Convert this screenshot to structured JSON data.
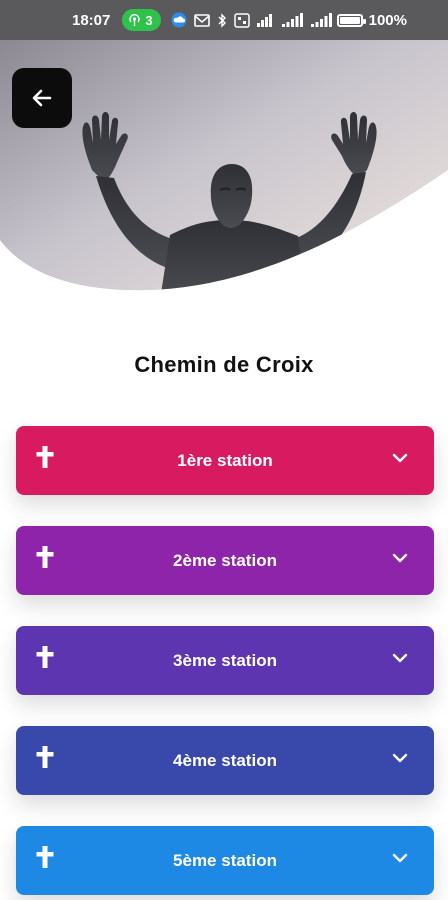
{
  "status_bar": {
    "time": "18:07",
    "hotspot_count": "3",
    "battery_percent": "100%",
    "battery_level": 1.0
  },
  "header": {
    "back_icon": "arrow-left-icon",
    "image": "christ-statue-raised-arms"
  },
  "page": {
    "title": "Chemin de Croix"
  },
  "stations": [
    {
      "label": "1ère station",
      "color": "#D81B60",
      "icon": "cross-icon"
    },
    {
      "label": "2ème station",
      "color": "#8E24AA",
      "icon": "cross-icon"
    },
    {
      "label": "3ème station",
      "color": "#5E35B1",
      "icon": "cross-icon"
    },
    {
      "label": "4ème station",
      "color": "#3949AB",
      "icon": "cross-icon"
    },
    {
      "label": "5ème station",
      "color": "#1E88E5",
      "icon": "cross-icon"
    }
  ]
}
